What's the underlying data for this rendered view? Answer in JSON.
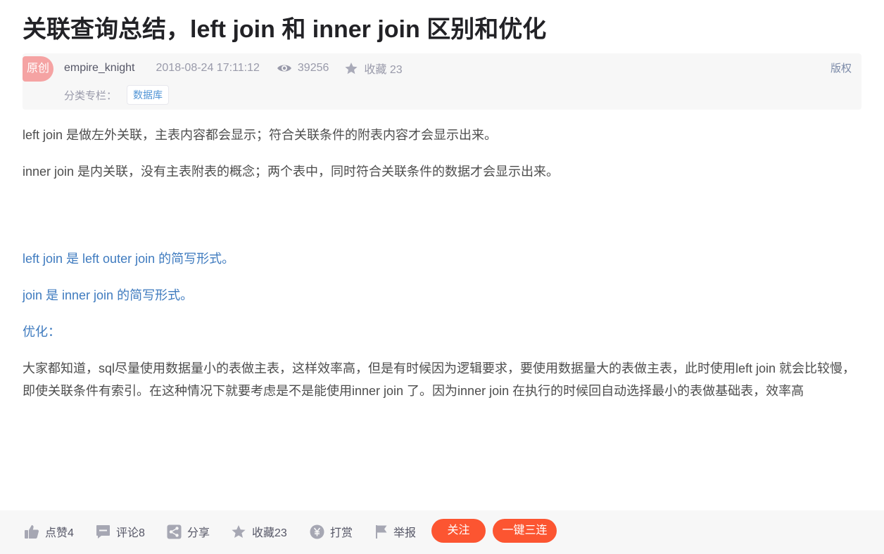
{
  "article": {
    "title": "关联查询总结，left join 和 inner join 区别和优化",
    "badge": "原创",
    "author": "empire_knight",
    "date": "2018-08-24 17:11:12",
    "views": "39256",
    "favorites_label": "收藏 23",
    "copyright": "版权",
    "category_label": "分类专栏：",
    "category_tag": "数据库"
  },
  "content": {
    "p1": "left join 是做左外关联，主表内容都会显示；符合关联条件的附表内容才会显示出来。",
    "p2": "inner join 是内关联，没有主表附表的概念；两个表中，同时符合关联条件的数据才会显示出来。",
    "p3": "left join 是 left outer join 的简写形式。",
    "p4": "join 是 inner join 的简写形式。",
    "p5": "优化：",
    "p6": "大家都知道，sql尽量使用数据量小的表做主表，这样效率高，但是有时候因为逻辑要求，要使用数据量大的表做主表，此时使用left join 就会比较慢，即使关联条件有索引。在这种情况下就要考虑是不是能使用inner join 了。因为inner join 在执行的时候回自动选择最小的表做基础表，效率高"
  },
  "toolbar": {
    "like": "点赞4",
    "comment": "评论8",
    "share": "分享",
    "favorite": "收藏23",
    "reward": "打赏",
    "report": "举报",
    "follow": "关注",
    "triple": "一键三连"
  },
  "colors": {
    "accent": "#fc5531",
    "link_blue": "#3f7bbf",
    "badge": "#f5a3a3"
  },
  "icons": [
    "eye-icon",
    "star-icon",
    "thumb-up-icon",
    "comment-icon",
    "share-icon",
    "favorite-icon",
    "reward-icon",
    "flag-icon"
  ]
}
